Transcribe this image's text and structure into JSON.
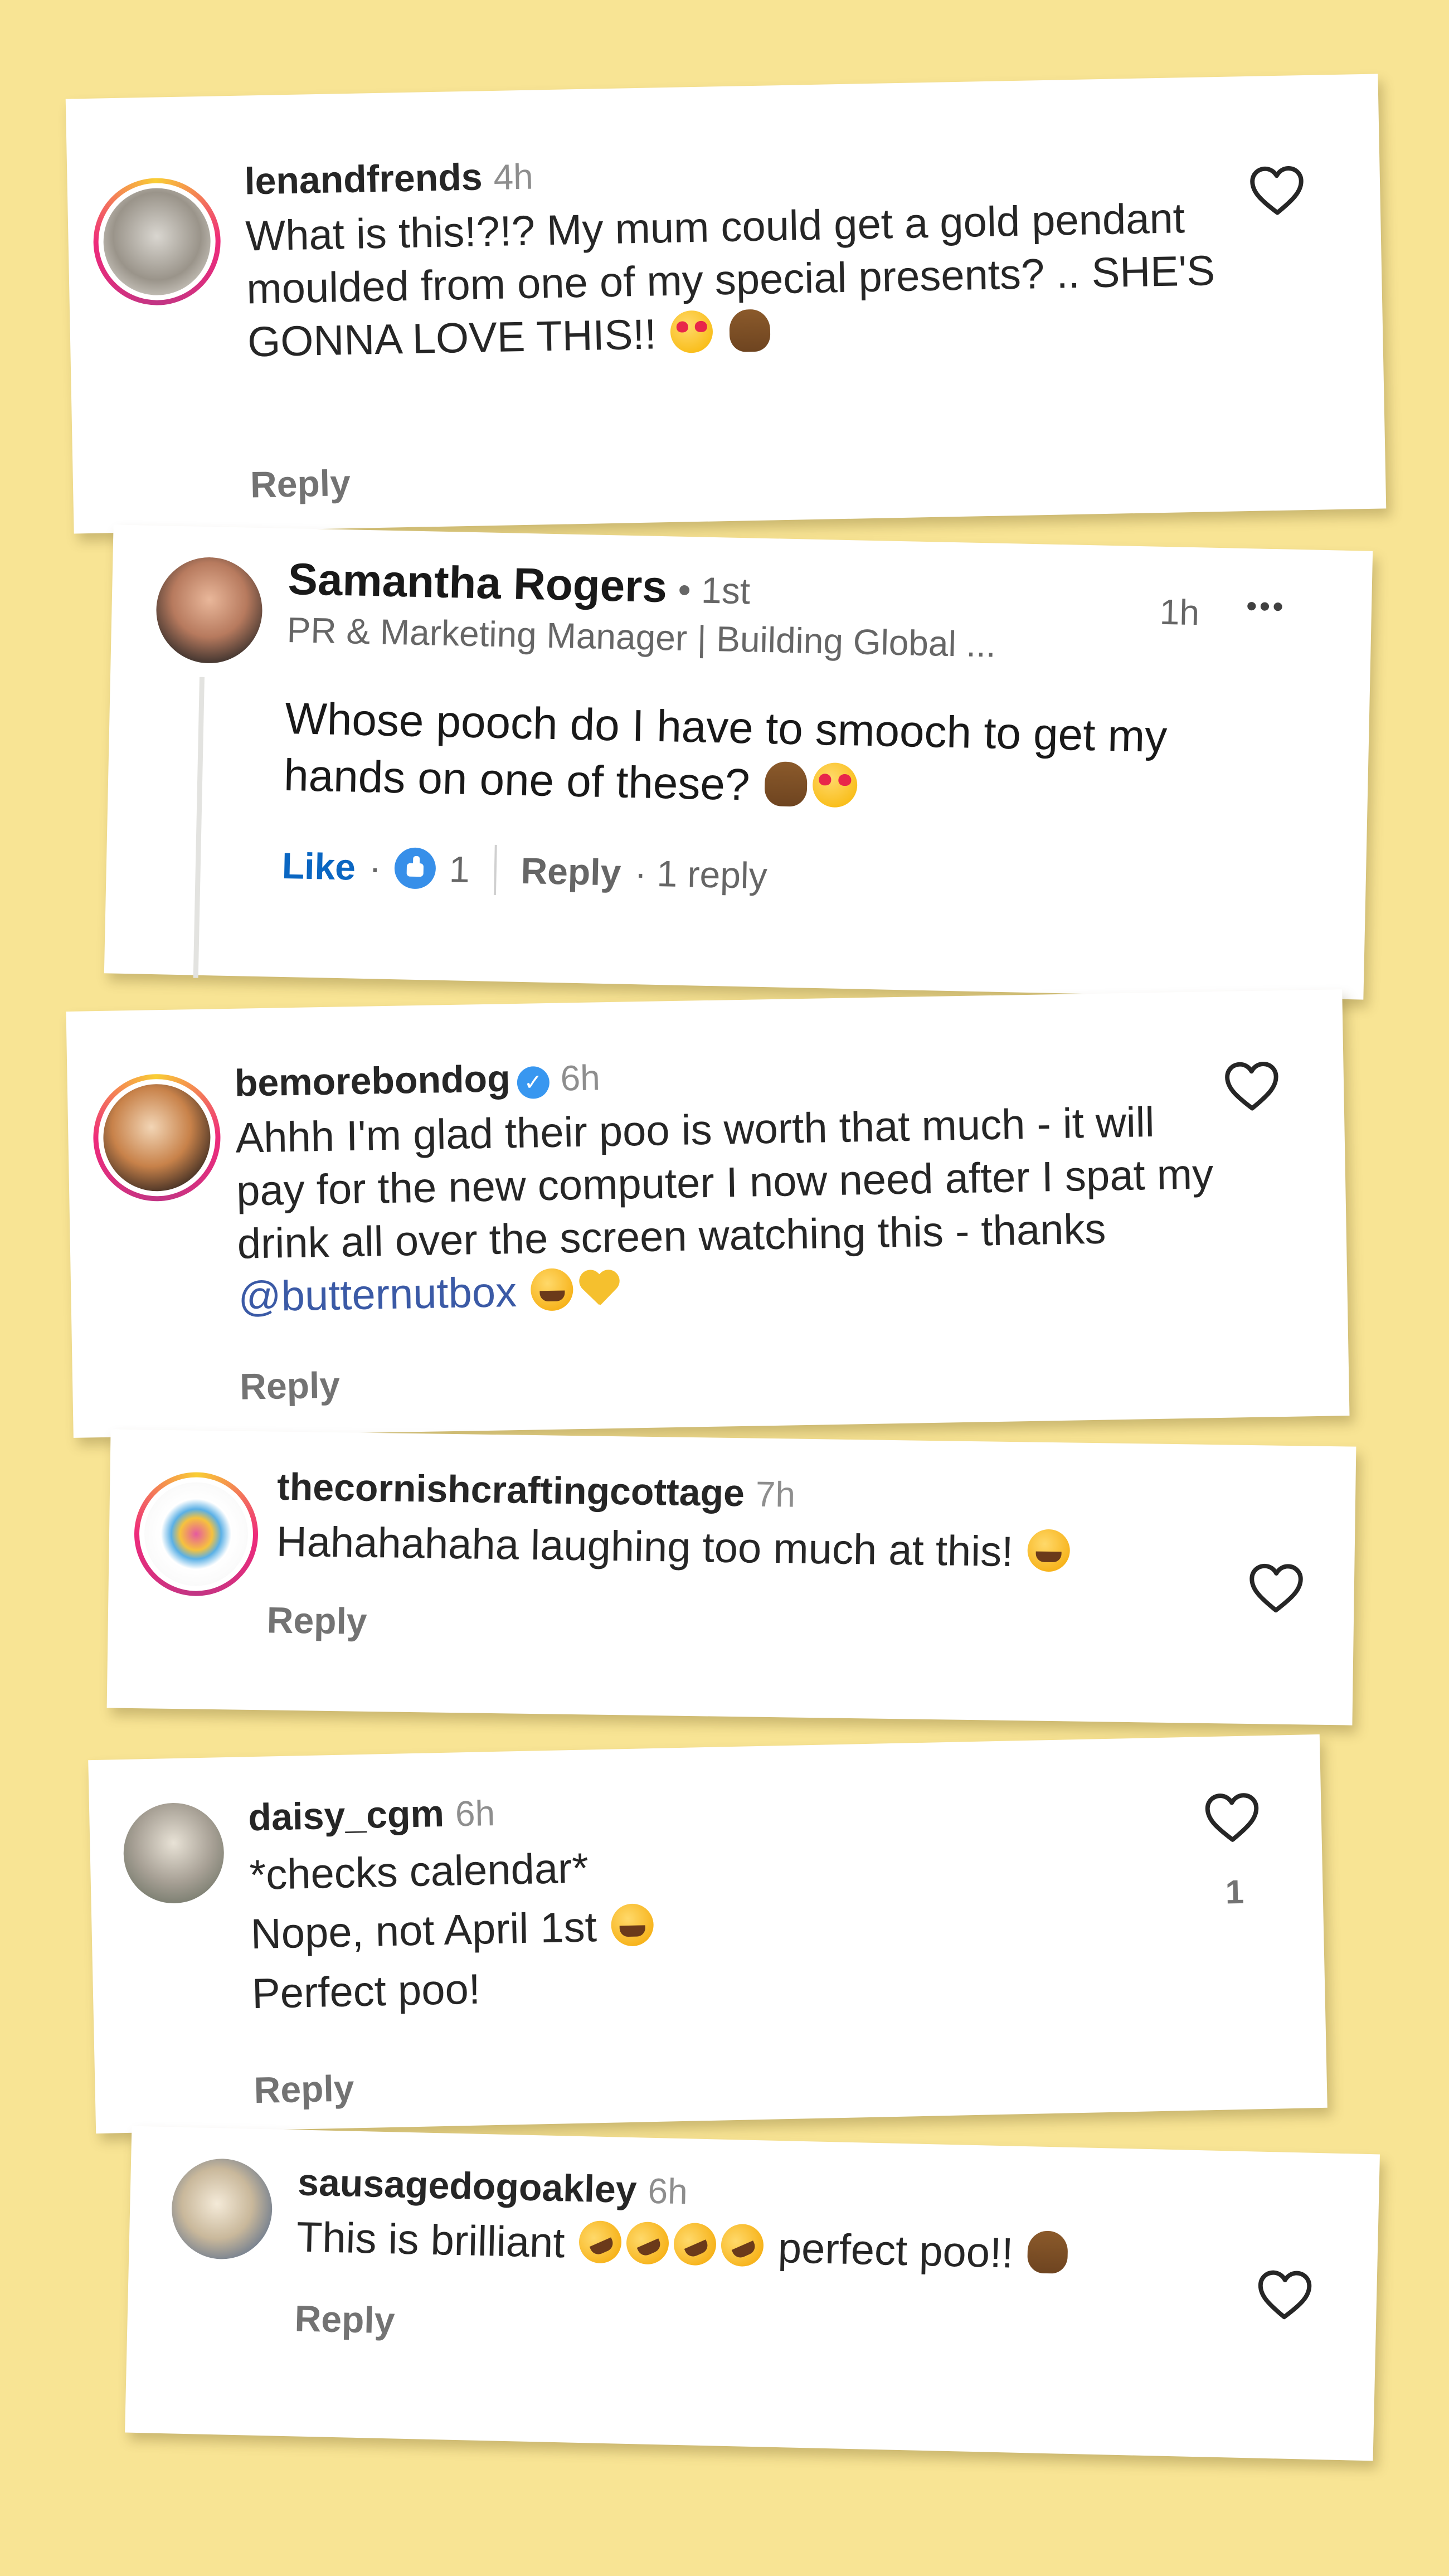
{
  "comments": [
    {
      "username": "lenandfrends",
      "time": "4h",
      "text": "What is this!?!? My mum could get a gold pendant moulded from one of my special presents? .. SHE'S GONNA LOVE THIS!!",
      "reply_label": "Reply"
    },
    {
      "name": "Samantha Rogers",
      "degree": "• 1st",
      "headline": "PR & Marketing Manager | Building Global ...",
      "time": "1h",
      "more": "•••",
      "text": "Whose pooch do I have to smooch to get my hands on one of these?",
      "like_label": "Like",
      "like_sep": "·",
      "reaction_count": "1",
      "reply_label": "Reply",
      "reply_count": "· 1 reply"
    },
    {
      "username": "bemorebondog",
      "verified_mark": "✓",
      "time": "6h",
      "text": "Ahhh I'm glad their poo is worth that much - it will pay for the new computer I now need after I spat my drink all over the screen watching this - thanks",
      "mention": "@butternutbox",
      "reply_label": "Reply"
    },
    {
      "username": "thecornishcraftingcottage",
      "time": "7h",
      "text": "Hahahahaha laughing too much at this!",
      "reply_label": "Reply"
    },
    {
      "username": "daisy_cgm",
      "time": "6h",
      "line1": "*checks calendar*",
      "line2": "Nope, not April 1st",
      "line3": "Perfect poo!",
      "like_count": "1",
      "reply_label": "Reply"
    },
    {
      "username": "sausagedogoakley",
      "time": "6h",
      "text_a": "This is brilliant",
      "text_b": "perfect poo!!",
      "reply_label": "Reply"
    }
  ],
  "colors": {
    "background": "#f8e494",
    "link_blue": "#0a66c2",
    "mention": "#3b5aa6",
    "secondary_text": "#8e8e8e"
  },
  "icons": [
    "heart-outline-icon",
    "verified-badge-icon",
    "like-reaction-icon",
    "more-options-icon",
    "heart-eyes-emoji",
    "poo-emoji",
    "joy-emoji",
    "rofl-emoji",
    "yellow-heart-emoji"
  ]
}
